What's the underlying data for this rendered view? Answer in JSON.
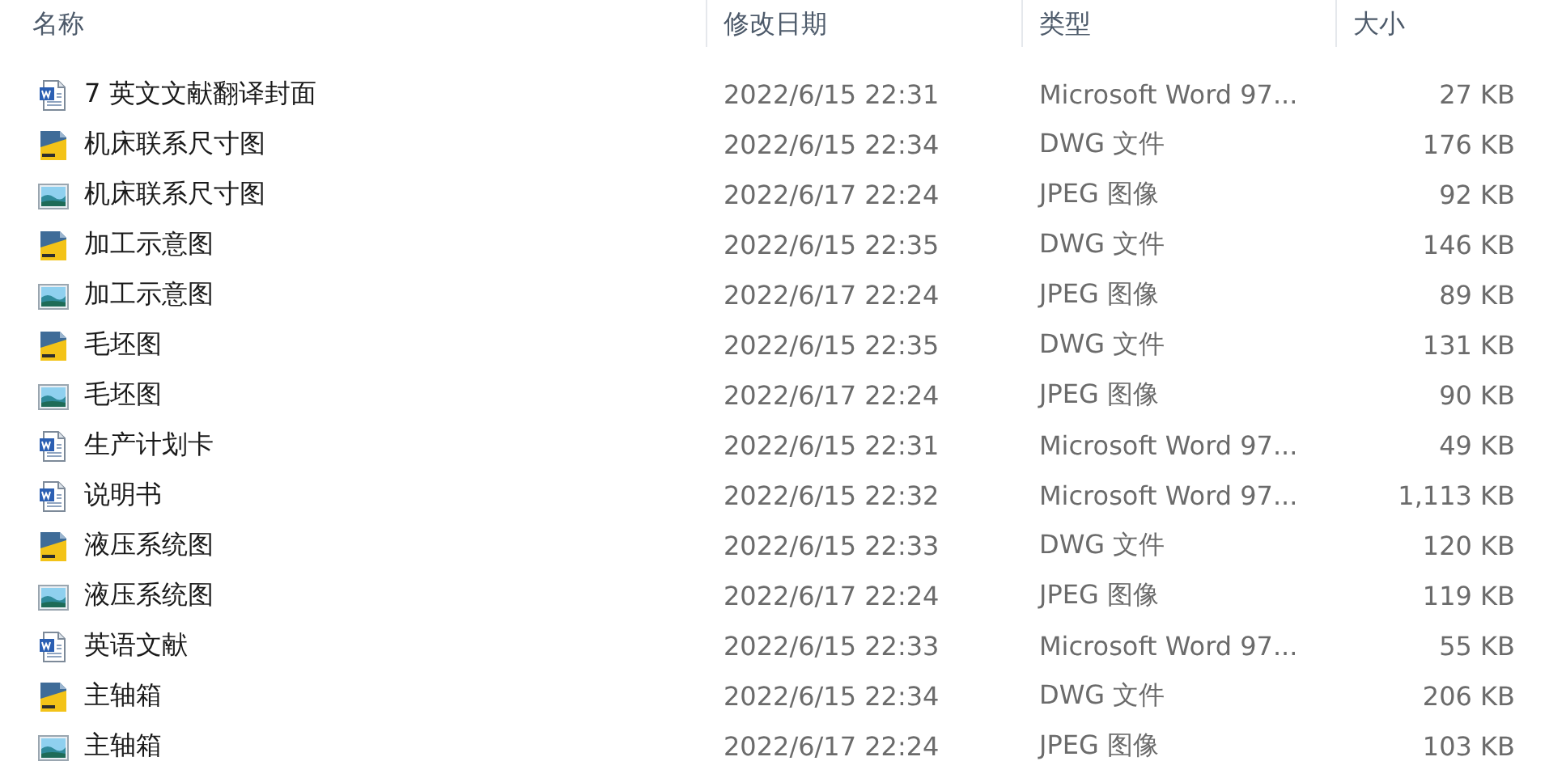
{
  "columns": [
    "名称",
    "修改日期",
    "类型",
    "大小"
  ],
  "rows": [
    {
      "kind": "word",
      "name": "7 英文文献翻译封面",
      "date": "2022/6/15 22:31",
      "type": "Microsoft Word 97...",
      "size": "27 KB"
    },
    {
      "kind": "dwg",
      "name": "机床联系尺寸图",
      "date": "2022/6/15 22:34",
      "type": "DWG 文件",
      "size": "176 KB"
    },
    {
      "kind": "jpeg",
      "name": "机床联系尺寸图",
      "date": "2022/6/17 22:24",
      "type": "JPEG 图像",
      "size": "92 KB"
    },
    {
      "kind": "dwg",
      "name": "加工示意图",
      "date": "2022/6/15 22:35",
      "type": "DWG 文件",
      "size": "146 KB"
    },
    {
      "kind": "jpeg",
      "name": "加工示意图",
      "date": "2022/6/17 22:24",
      "type": "JPEG 图像",
      "size": "89 KB"
    },
    {
      "kind": "dwg",
      "name": "毛坯图",
      "date": "2022/6/15 22:35",
      "type": "DWG 文件",
      "size": "131 KB"
    },
    {
      "kind": "jpeg",
      "name": "毛坯图",
      "date": "2022/6/17 22:24",
      "type": "JPEG 图像",
      "size": "90 KB"
    },
    {
      "kind": "word",
      "name": "生产计划卡",
      "date": "2022/6/15 22:31",
      "type": "Microsoft Word 97...",
      "size": "49 KB"
    },
    {
      "kind": "word",
      "name": "说明书",
      "date": "2022/6/15 22:32",
      "type": "Microsoft Word 97...",
      "size": "1,113 KB"
    },
    {
      "kind": "dwg",
      "name": "液压系统图",
      "date": "2022/6/15 22:33",
      "type": "DWG 文件",
      "size": "120 KB"
    },
    {
      "kind": "jpeg",
      "name": "液压系统图",
      "date": "2022/6/17 22:24",
      "type": "JPEG 图像",
      "size": "119 KB"
    },
    {
      "kind": "word",
      "name": "英语文献",
      "date": "2022/6/15 22:33",
      "type": "Microsoft Word 97...",
      "size": "55 KB"
    },
    {
      "kind": "dwg",
      "name": "主轴箱",
      "date": "2022/6/15 22:34",
      "type": "DWG 文件",
      "size": "206 KB"
    },
    {
      "kind": "jpeg",
      "name": "主轴箱",
      "date": "2022/6/17 22:24",
      "type": "JPEG 图像",
      "size": "103 KB"
    }
  ]
}
